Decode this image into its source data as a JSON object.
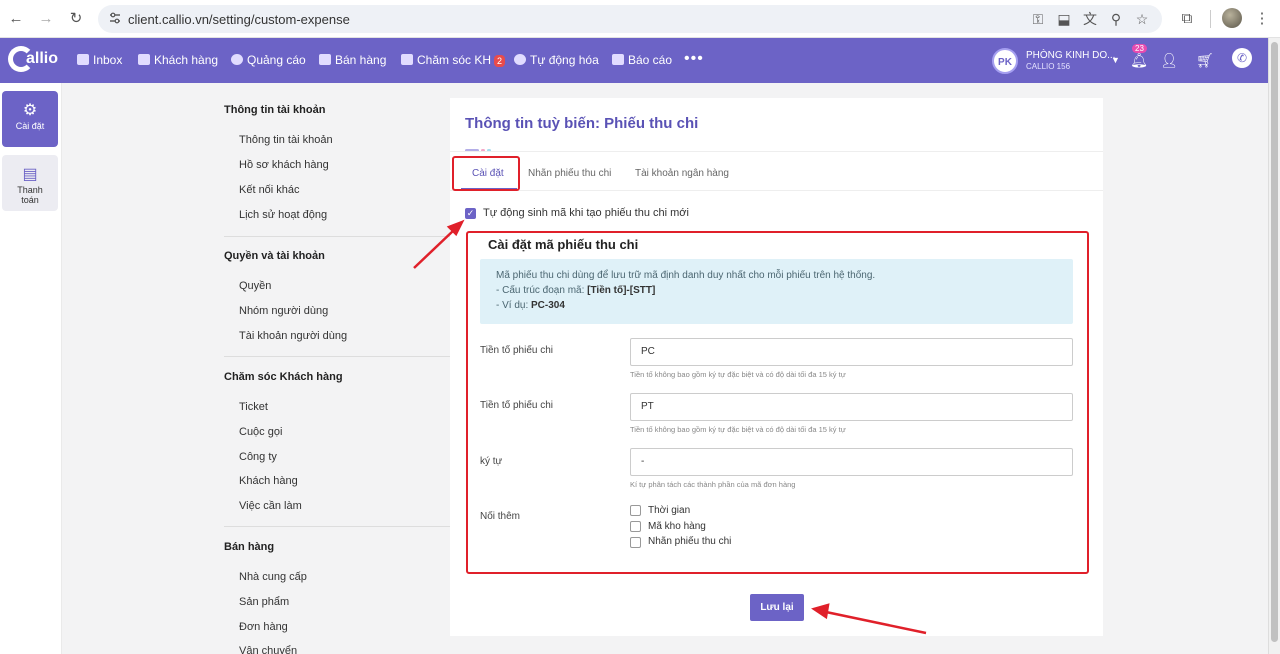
{
  "browser": {
    "url": "client.callio.vn/setting/custom-expense"
  },
  "app": {
    "logo_text": "allio",
    "nav": [
      {
        "label": "Inbox",
        "icon": "inbox-icon"
      },
      {
        "label": "Khách hàng",
        "icon": "customers-icon"
      },
      {
        "label": "Quảng cáo",
        "icon": "ads-icon"
      },
      {
        "label": "Bán hàng",
        "icon": "sales-icon"
      },
      {
        "label": "Chăm sóc KH",
        "icon": "care-icon",
        "badge": "2"
      },
      {
        "label": "Tự động hóa",
        "icon": "automation-icon"
      },
      {
        "label": "Báo cáo",
        "icon": "report-icon"
      }
    ],
    "more": "•••",
    "user": {
      "initials": "PK",
      "name": "PHÒNG KINH DO...",
      "sub": "CALLIO 156"
    },
    "bell_badge": "23"
  },
  "rail": [
    {
      "label": "Cài đặt",
      "icon": "gear-icon",
      "active": true
    },
    {
      "label": "Thanh toán",
      "icon": "receipt-icon",
      "active": false
    }
  ],
  "menu": {
    "sections": [
      {
        "title": "Thông tin tài khoản",
        "items": [
          "Thông tin tài khoản",
          "Hồ sơ khách hàng",
          "Kết nối khác",
          "Lịch sử hoạt động"
        ]
      },
      {
        "title": "Quyền và tài khoản",
        "items": [
          "Quyền",
          "Nhóm người dùng",
          "Tài khoản người dùng"
        ]
      },
      {
        "title": "Chăm sóc Khách hàng",
        "items": [
          "Ticket",
          "Cuộc gọi",
          "Công ty",
          "Khách hàng",
          "Việc cần làm"
        ]
      },
      {
        "title": "Bán hàng",
        "items": [
          "Nhà cung cấp",
          "Sản phẩm",
          "Đơn hàng",
          "Vận chuyển"
        ]
      }
    ]
  },
  "page": {
    "title": "Thông tin tuỳ biến: Phiếu thu chi",
    "tabs": [
      "Cài đặt",
      "Nhãn phiếu thu chi",
      "Tài khoản ngân hàng"
    ],
    "active_tab": "Cài đặt",
    "auto_generate_label": "Tự động sinh mã khi tạo phiếu thu chi mới",
    "auto_generate_checked": true,
    "section_title": "Cài đặt mã phiếu thu chi",
    "info": {
      "line1": "Mã phiếu thu chi dùng để lưu trữ mã định danh duy nhất cho mỗi phiếu trên hệ thống.",
      "line2_prefix": "- Cấu trúc đoạn mã: ",
      "line2_bold": "[Tiền tố]-[STT]",
      "line3_prefix": "- Ví dụ: ",
      "line3_bold": "PC-304"
    },
    "fields": [
      {
        "label": "Tiền tố phiếu chi",
        "value": "PC",
        "help": "Tiền tố không bao gồm ký tự đặc biệt và có độ dài tối đa 15 ký tự"
      },
      {
        "label": "Tiền tố phiếu chi",
        "value": "PT",
        "help": "Tiền tố không bao gồm ký tự đặc biệt và có độ dài tối đa 15 ký tự"
      },
      {
        "label": "ký tự",
        "value": "-",
        "help": "Kí tự phân tách các thành phần của mã đơn hàng"
      }
    ],
    "append_label": "Nối thêm",
    "append_options": [
      "Thời gian",
      "Mã kho hàng",
      "Nhãn phiếu thu chi"
    ],
    "save_label": "Lưu lại"
  },
  "colors": {
    "brand": "#6c63c6",
    "annotation": "#e0202a"
  }
}
